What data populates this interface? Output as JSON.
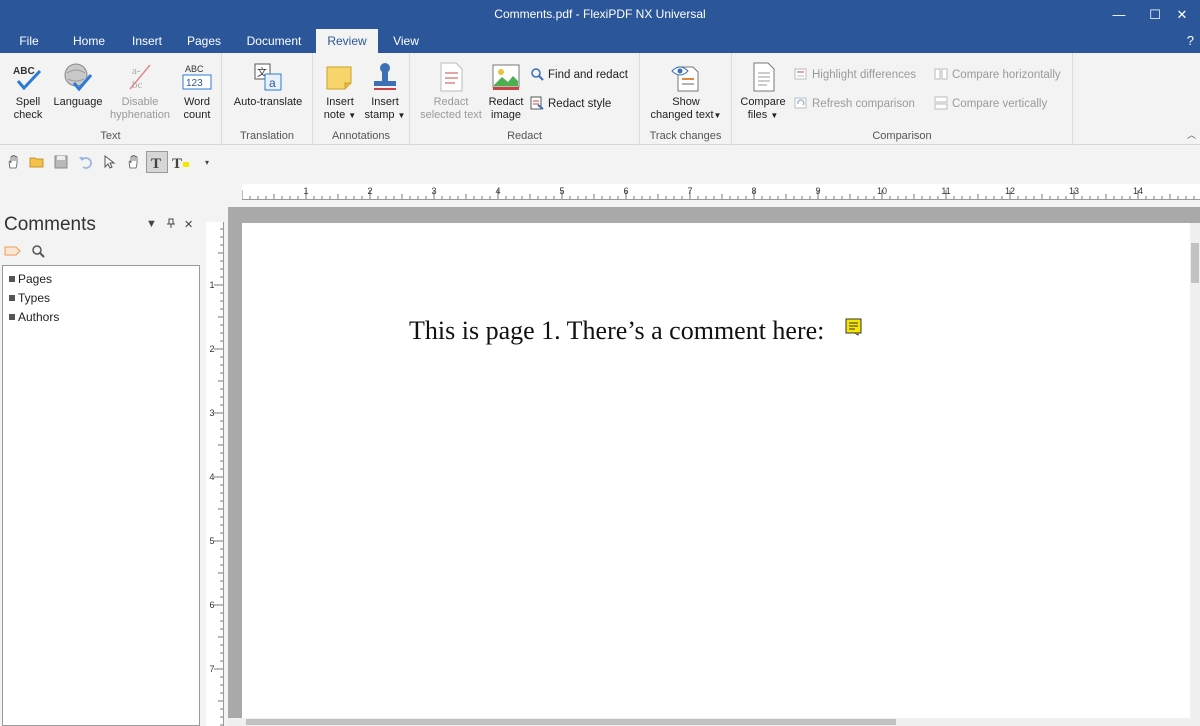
{
  "window": {
    "title": "Comments.pdf - FlexiPDF NX Universal",
    "minimize": "—",
    "maximize": "☐",
    "close": "✕"
  },
  "menu": {
    "file": "File",
    "home": "Home",
    "insert": "Insert",
    "pages": "Pages",
    "document": "Document",
    "review": "Review",
    "view": "View",
    "help": "?"
  },
  "ribbon": {
    "text_group": {
      "label": "Text",
      "spell_check": [
        "Spell",
        "check"
      ],
      "language": "Language",
      "disable_hyphenation": [
        "Disable",
        "hyphenation"
      ],
      "word_count": [
        "Word",
        "count"
      ]
    },
    "translation_group": {
      "label": "Translation",
      "auto_translate": "Auto-translate"
    },
    "annotations_group": {
      "label": "Annotations",
      "insert_note": [
        "Insert",
        "note"
      ],
      "insert_stamp": [
        "Insert",
        "stamp"
      ]
    },
    "redact_group": {
      "label": "Redact",
      "redact_selected_text": [
        "Redact",
        "selected text"
      ],
      "redact_image": [
        "Redact",
        "image"
      ],
      "find_and_redact": "Find and redact",
      "redact_style": "Redact style"
    },
    "track_group": {
      "label": "Track changes",
      "show_changed_text": [
        "Show",
        "changed text"
      ]
    },
    "comparison_group": {
      "label": "Comparison",
      "compare_files": [
        "Compare",
        "files"
      ],
      "highlight_differences": "Highlight differences",
      "refresh_comparison": "Refresh comparison",
      "compare_horizontally": "Compare horizontally",
      "compare_vertically": "Compare vertically"
    }
  },
  "comments_pane": {
    "title": "Comments",
    "tree": [
      "Pages",
      "Types",
      "Authors"
    ]
  },
  "ruler": {
    "h_marks": [
      "1",
      "2",
      "3",
      "4",
      "5",
      "6",
      "7",
      "8",
      "9",
      "10",
      "11",
      "12",
      "13",
      "14"
    ],
    "v_marks": [
      "1",
      "2",
      "3",
      "4",
      "5",
      "6",
      "7"
    ]
  },
  "document": {
    "text": "This is page 1. There’s a comment here:"
  },
  "colors": {
    "accent": "#2b579a",
    "note": "#f5e600"
  }
}
